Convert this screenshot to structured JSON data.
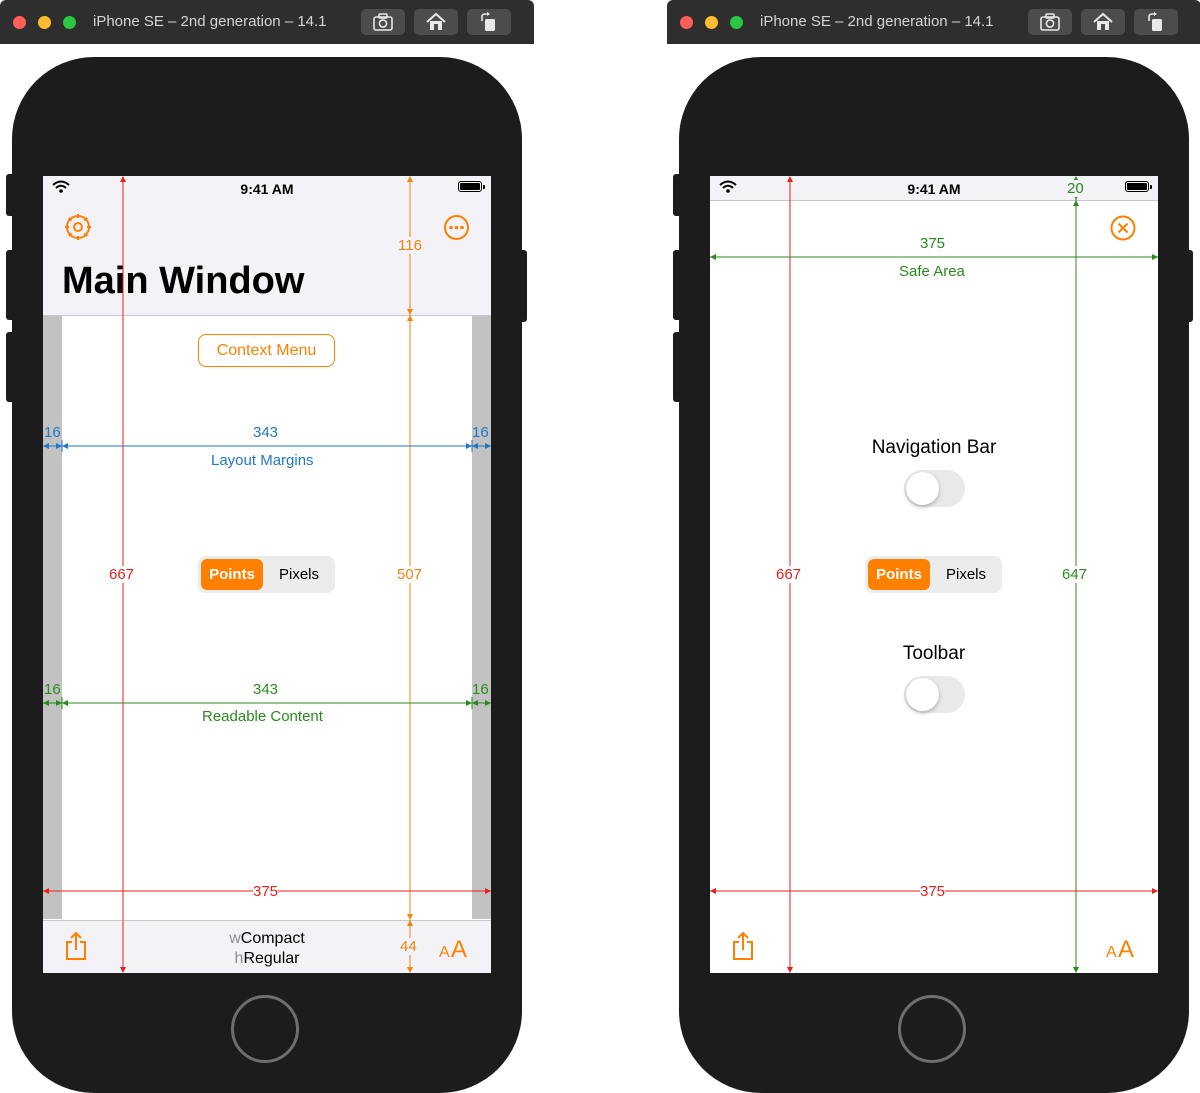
{
  "simulator_left": {
    "window_title": "iPhone SE – 2nd generation – 14.1",
    "status_time": "9:41 AM",
    "nav_title": "Main Window",
    "context_button": "Context Menu",
    "segmented": {
      "options": [
        "Points",
        "Pixels"
      ],
      "selected": "Points"
    },
    "bottom_size_class": {
      "w_prefix": "w",
      "w_value": "Compact",
      "h_prefix": "h",
      "h_value": "Regular"
    },
    "text_size_button": "AA",
    "dimensions": {
      "screen_height": "667",
      "nav_bar_height": "116",
      "content_height": "507",
      "toolbar_height": "44",
      "screen_width": "375",
      "layout_margin_left": "16",
      "layout_width": "343",
      "layout_margin_right": "16",
      "layout_label": "Layout Margins",
      "readable_margin_left": "16",
      "readable_width": "343",
      "readable_margin_right": "16",
      "readable_label": "Readable Content"
    },
    "icons": [
      "gear-icon",
      "ellipsis-circle-icon",
      "share-icon",
      "text-size-icon"
    ]
  },
  "simulator_right": {
    "window_title": "iPhone SE – 2nd generation – 14.1",
    "status_time": "9:41 AM",
    "navigation_bar_label": "Navigation Bar",
    "navigation_bar_toggle": false,
    "toolbar_label": "Toolbar",
    "toolbar_toggle": false,
    "segmented": {
      "options": [
        "Points",
        "Pixels"
      ],
      "selected": "Points"
    },
    "text_size_button": "AA",
    "dimensions": {
      "status_bar_height": "20",
      "safe_area_width": "375",
      "safe_area_label": "Safe Area",
      "screen_height": "667",
      "safe_area_height": "647",
      "screen_width": "375"
    },
    "icons": [
      "close-circle-icon",
      "share-icon",
      "text-size-icon"
    ]
  },
  "colors": {
    "accent": "#ff8000",
    "dimension_red": "#e8201a",
    "dimension_orange": "#f5820a",
    "dimension_blue": "#1f78c8",
    "dimension_green": "#2b8a1e",
    "device_body": "#1c1c1c",
    "titlebar": "#2e2e2e"
  }
}
